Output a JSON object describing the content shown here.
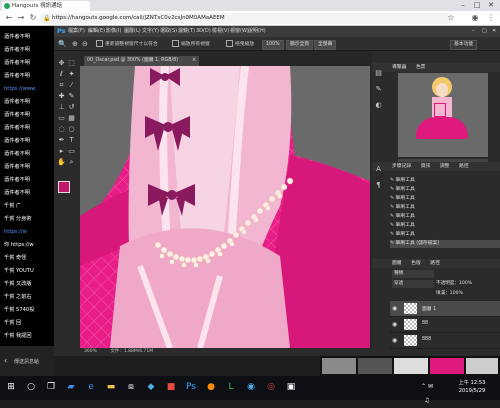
{
  "browser": {
    "tab_title": "Hangouts 視訊通話",
    "url": "https://hangouts.google.com/call/jZNTxC0v2csJn0M0AMaAEEM",
    "back_icon": "back-arrow-icon",
    "forward_icon": "forward-arrow-icon",
    "reload_icon": "reload-icon",
    "lock_icon": "lock-icon",
    "star_icon": "star-icon",
    "menu_icon": "more-vert-icon"
  },
  "hangouts": {
    "items": [
      {
        "text": "酒件者不明"
      },
      {
        "text": "酒件者不明"
      },
      {
        "text": "酒件者不明"
      },
      {
        "text": "酒件者不明"
      },
      {
        "text": "https://www",
        "link": true
      },
      {
        "text": "酒件者不明"
      },
      {
        "text": "酒件者不明"
      },
      {
        "text": "酒件者不明"
      },
      {
        "text": "酒件者不明"
      },
      {
        "text": "酒件者不明"
      },
      {
        "text": "酒件者不明"
      },
      {
        "text": "酒件者不明"
      },
      {
        "text": "酒件者不明"
      },
      {
        "text": "千賀 广"
      },
      {
        "text": "千賀 分身術"
      },
      {
        "text": "https://w",
        "link": true
      },
      {
        "text": "你 https://w"
      },
      {
        "text": "千賀 奇怪"
      },
      {
        "text": "千賀 YOUTU"
      },
      {
        "text": "千賀 又改版"
      },
      {
        "text": "千賀 之前右"
      },
      {
        "text": "千賀 5740投"
      },
      {
        "text": "千賀 回"
      },
      {
        "text": "千賀 我認回"
      }
    ],
    "bottom_label": "傳送訊息給"
  },
  "ps": {
    "logo": "Ps",
    "menu": [
      "檔案(F)",
      "編輯(E)",
      "影像(I)",
      "圖層(L)",
      "文字(Y)",
      "選取(S)",
      "濾鏡(T)",
      "3D(D)",
      "檢視(V)",
      "視窗(W)",
      "說明(H)"
    ],
    "options": {
      "resize": "重新調整視窗尺寸以符合",
      "zoom_all": "縮放所有視窗",
      "scrubby": "拖曳縮放",
      "btn_100": "100%",
      "btn_fit": "顯示全頁",
      "btn_fill": "全螢幕"
    },
    "workspace": "基本功能",
    "doc_tab": "00_Oscar.psd @ 300% (圖層 1, RGB/8)",
    "status_zoom": "300%",
    "status_doc": "文件：1.88M/6.71M",
    "navigator": {
      "tab1": "導覽器",
      "tab2": "色票"
    },
    "history": {
      "tabs": [
        "步驟記錄",
        "資訊",
        "調整",
        "路徑"
      ],
      "items": [
        "筆刷工具",
        "筆刷工具",
        "筆刷工具",
        "筆刷工具",
        "筆刷工具",
        "筆刷工具",
        "筆刷工具",
        "筆刷工具 (儲存檔案)"
      ]
    },
    "layers": {
      "tabs": [
        "圖層",
        "色版",
        "路徑"
      ],
      "filter": "種類",
      "blend": "穿透",
      "opacity_label": "不透明度：",
      "opacity": "100%",
      "fill_label": "填滿：",
      "fill": "100%",
      "items": [
        "圖層 1",
        "88",
        "888"
      ]
    }
  },
  "taskbar": {
    "time": "上午 12:53",
    "date": "2019/5/29"
  }
}
